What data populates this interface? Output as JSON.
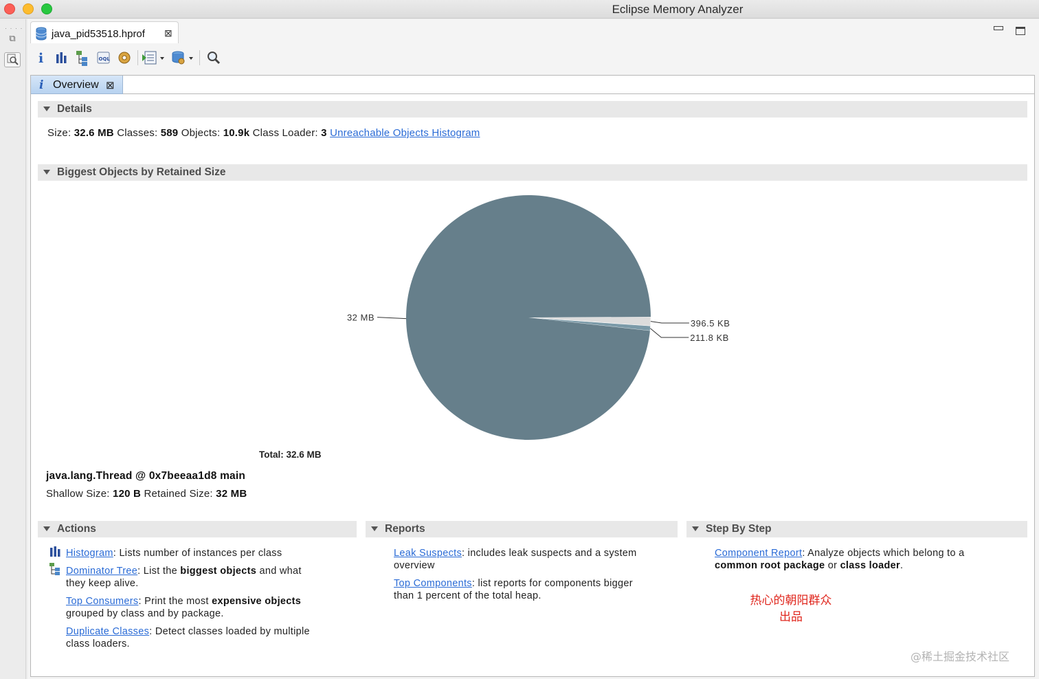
{
  "window": {
    "title": "Eclipse Memory Analyzer"
  },
  "editor": {
    "file_tab": "java_pid53518.hprof",
    "overview_tab": "Overview"
  },
  "toolbar": {
    "items": [
      "info-icon",
      "histogram-icon",
      "dominator-tree-icon",
      "oql-icon",
      "heap-dump-details-icon",
      "reports-dropdown-icon",
      "query-browser-dropdown-icon",
      "search-icon"
    ]
  },
  "details": {
    "header": "Details",
    "size_label": "Size:",
    "size_value": "32.6 MB",
    "classes_label": "Classes:",
    "classes_value": "589",
    "objects_label": "Objects:",
    "objects_value": "10.9k",
    "classloader_label": "Class Loader:",
    "classloader_value": "3",
    "unreachable_link": "Unreachable Objects Histogram"
  },
  "biggest": {
    "header": "Biggest Objects by Retained Size",
    "total": "Total: 32.6 MB",
    "object_name": "java.lang.Thread @ 0x7beeaa1d8 main",
    "shallow_label": "Shallow Size:",
    "shallow_value": "120 B",
    "retained_label": "Retained Size:",
    "retained_value": "32 MB"
  },
  "chart_data": {
    "type": "pie",
    "total_kb": 33382,
    "slices": [
      {
        "label": "32 MB",
        "value_kb": 32768,
        "color": "#667f8b"
      },
      {
        "label": "396.5 KB",
        "value_kb": 396.5,
        "color": "#dcdcdc"
      },
      {
        "label": "211.8 KB",
        "value_kb": 211.8,
        "color": "#7b9aa8"
      }
    ]
  },
  "actions": {
    "header": "Actions",
    "histogram_link": "Histogram",
    "histogram_text": ": Lists number of instances per class",
    "dominator_link": "Dominator Tree",
    "dominator_pre": ": List the ",
    "dominator_bold": "biggest objects",
    "dominator_post": " and what",
    "dominator_line2": "they keep alive.",
    "consumers_link": "Top Consumers",
    "consumers_pre": ": Print the most ",
    "consumers_bold": "expensive objects",
    "consumers_line2": "grouped by class and by package.",
    "duplicate_link": "Duplicate Classes",
    "duplicate_text": ": Detect classes loaded by multiple",
    "duplicate_line2": "class loaders."
  },
  "reports": {
    "header": "Reports",
    "leak_link": "Leak Suspects",
    "leak_text": ": includes leak suspects and a system",
    "leak_line2": "overview",
    "components_link": "Top Components",
    "components_text": ": list reports for components bigger",
    "components_line2": "than 1 percent of the total heap."
  },
  "step_by_step": {
    "header": "Step By Step",
    "component_link": "Component Report",
    "component_text": ": Analyze objects which belong to a",
    "component_bold1": "common root package",
    "component_mid": " or ",
    "component_bold2": "class loader",
    "component_end": "."
  },
  "watermark": {
    "red_line1": "热心的朝阳群众",
    "red_line2": "出品",
    "grey": "@稀土掘金技术社区"
  },
  "colors": {
    "pie_main": "#667f8b",
    "link": "#2a6bd6",
    "watermark_red": "#e0281f"
  }
}
